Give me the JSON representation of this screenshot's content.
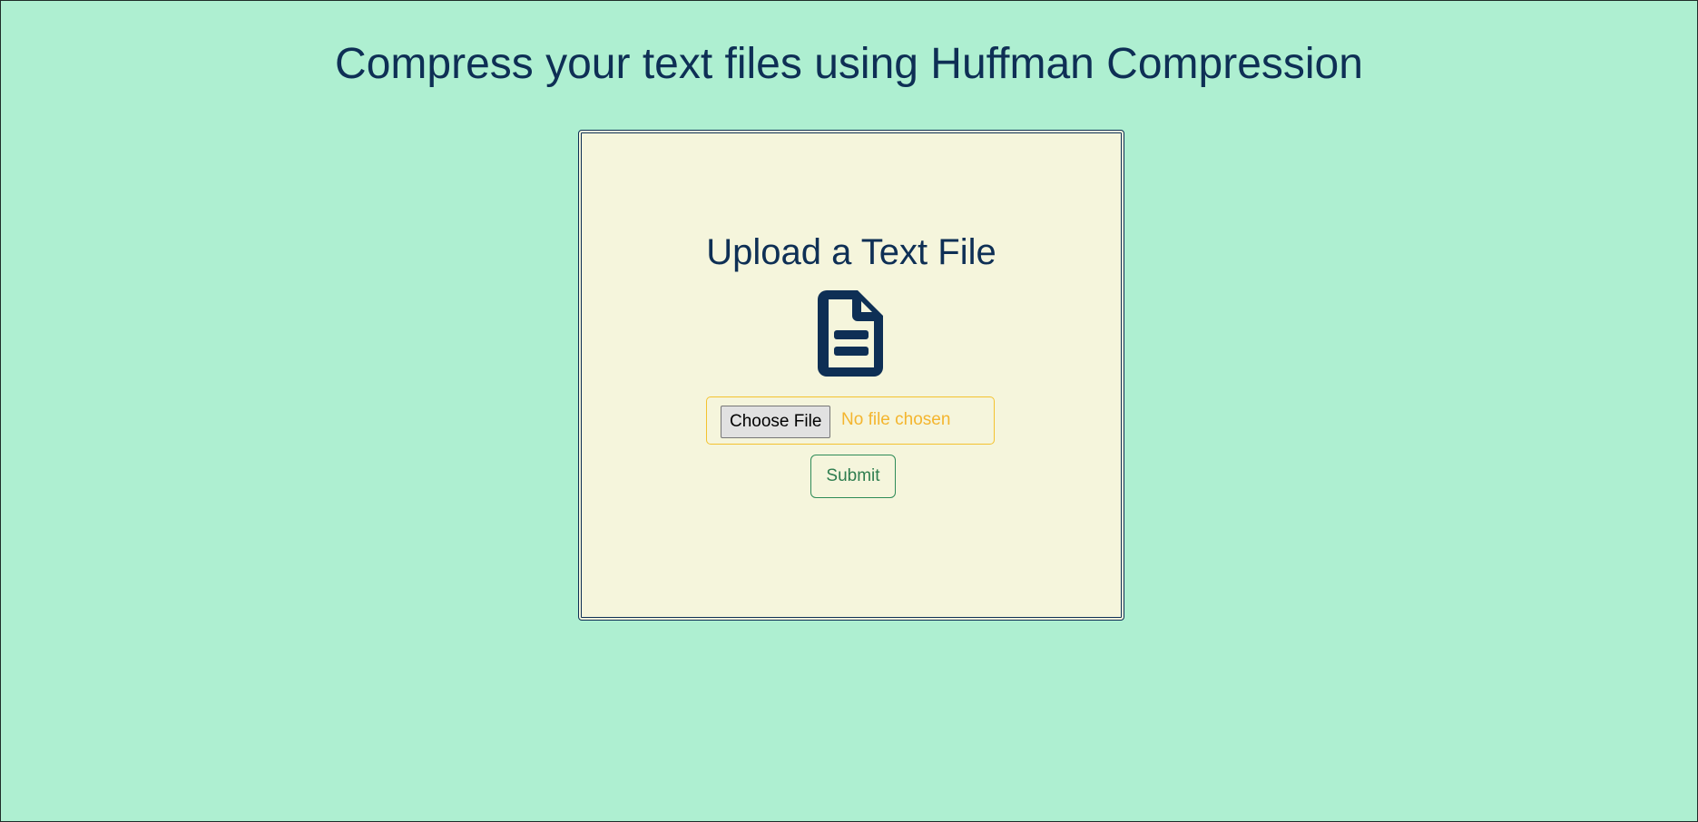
{
  "header": {
    "title": "Compress your text files using Huffman Compression"
  },
  "upload_card": {
    "heading": "Upload a Text File",
    "icon": "file-text-icon",
    "file_input": {
      "button_label": "Choose File",
      "status_text": "No file chosen"
    },
    "submit_label": "Submit"
  },
  "colors": {
    "page_background": "#aeefd1",
    "card_background": "#f5f5dc",
    "primary_text": "#0e2f55",
    "file_input_accent": "#f4c22f",
    "submit_accent": "#2e8b57"
  }
}
